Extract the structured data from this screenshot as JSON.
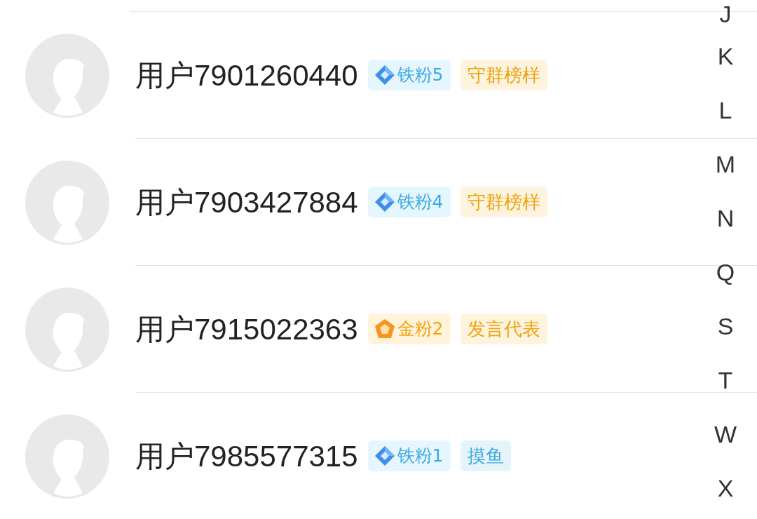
{
  "contacts": [
    {
      "name": "用户7901260440",
      "fan_badge": {
        "kind": "iron",
        "label": "铁粉5"
      },
      "tag": {
        "label": "守群榜样",
        "color": "#f0a30a"
      }
    },
    {
      "name": "用户7903427884",
      "fan_badge": {
        "kind": "iron",
        "label": "铁粉4"
      },
      "tag": {
        "label": "守群榜样",
        "color": "#f0a30a"
      }
    },
    {
      "name": "用户7915022363",
      "fan_badge": {
        "kind": "gold",
        "label": "金粉2"
      },
      "tag": {
        "label": "发言代表",
        "color": "#f0a30a"
      }
    },
    {
      "name": "用户7985577315",
      "fan_badge": {
        "kind": "iron",
        "label": "铁粉1"
      },
      "tag": {
        "label": "摸鱼",
        "color": "#3aa8e0"
      }
    }
  ],
  "index_letters": [
    "J",
    "K",
    "L",
    "M",
    "N",
    "Q",
    "S",
    "T",
    "W",
    "X"
  ]
}
